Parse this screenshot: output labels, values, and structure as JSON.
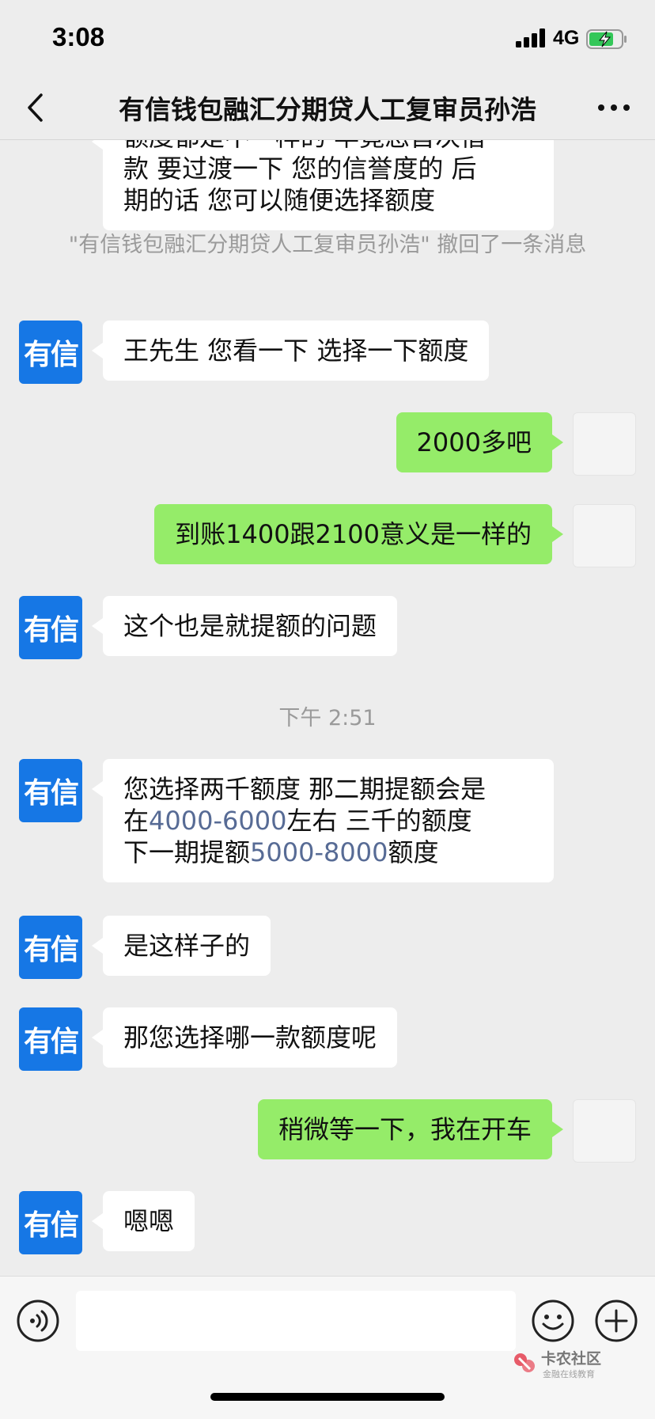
{
  "status_bar": {
    "time": "3:08",
    "network": "4G"
  },
  "header": {
    "title": "有信钱包融汇分期贷人工复审员孙浩"
  },
  "messages": {
    "partial_top": {
      "line1": "额度都是不一样的 毕竟您首次借",
      "line2": "款 要过渡一下 您的信誉度的 后",
      "line3": "期的话  您可以随便选择额度"
    },
    "recall_note": "\"有信钱包融汇分期贷人工复审员孙浩\" 撤回了一条消息",
    "avatar_text": "有信",
    "m1": "王先生 您看一下 选择一下额度",
    "m2": "2000多吧",
    "m3": "到账1400跟2100意义是一样的",
    "m4": "这个也是就提额的问题",
    "time_divider": "下午 2:51",
    "m5": {
      "p1": "您选择两千额度  那二期提额会是",
      "p2a": "在",
      "p2b": "4000-6000",
      "p2c": "左右    三千的额度",
      "p3a": " 下一期提额",
      "p3b": "5000-8000",
      "p3c": "额度"
    },
    "m6": "是这样子的",
    "m7": "那您选择哪一款额度呢",
    "m8": "稍微等一下，我在开车",
    "m9": "嗯嗯"
  },
  "watermark": {
    "title": "卡农社区",
    "subtitle": "金融在线教育"
  },
  "colors": {
    "outgoing_bubble": "#95ec69",
    "incoming_bubble": "#ffffff",
    "avatar_brand": "#1677e5",
    "link_number": "#576b95"
  },
  "icons": [
    "back-chevron-icon",
    "more-icon",
    "voice-icon",
    "emoji-icon",
    "plus-icon",
    "battery-icon",
    "signal-icon"
  ]
}
